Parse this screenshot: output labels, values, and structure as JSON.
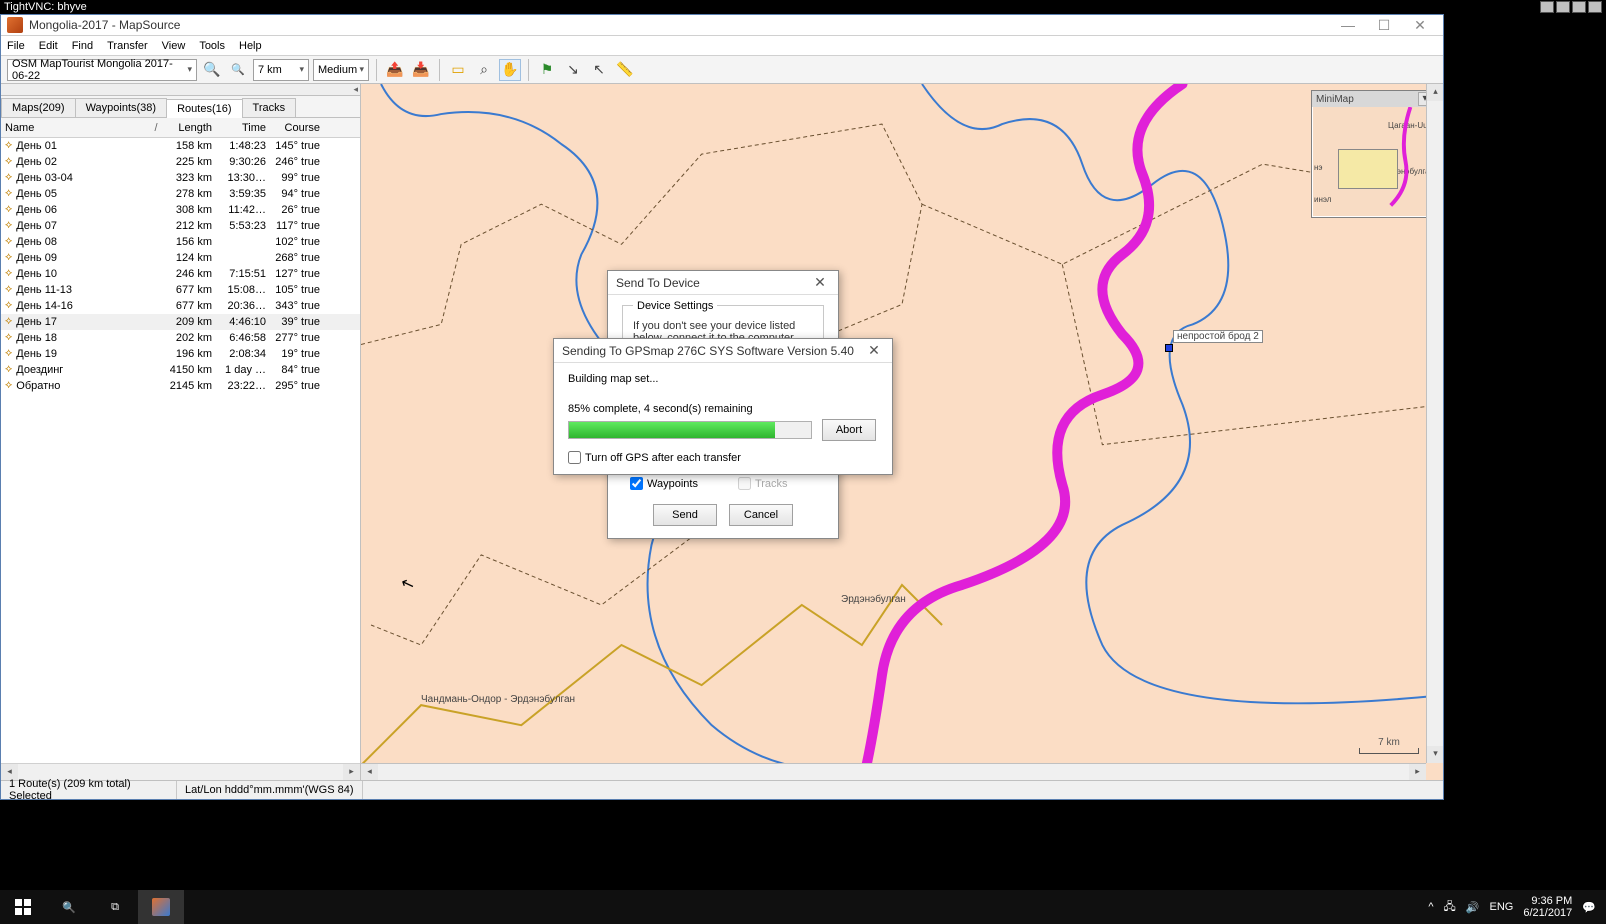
{
  "vnc": {
    "title": "TightVNC: bhyve"
  },
  "app": {
    "title": "Mongolia-2017 - MapSource",
    "menu": [
      "File",
      "Edit",
      "Find",
      "Transfer",
      "View",
      "Tools",
      "Help"
    ],
    "map_product": "OSM MapTourist Mongolia 2017-06-22",
    "zoom_scale": "7 km",
    "detail": "Medium"
  },
  "tabs": {
    "maps": "Maps(209)",
    "waypoints": "Waypoints(38)",
    "routes": "Routes(16)",
    "tracks": "Tracks"
  },
  "grid": {
    "cols": {
      "name": "Name",
      "sort": "/",
      "length": "Length",
      "time": "Time",
      "course": "Course"
    },
    "rows": [
      {
        "name": "День 01",
        "len": "158 km",
        "time": "1:48:23",
        "course": "145° true"
      },
      {
        "name": "День 02",
        "len": "225 km",
        "time": "9:30:26",
        "course": "246° true"
      },
      {
        "name": "День 03-04",
        "len": "323 km",
        "time": "13:30…",
        "course": "99° true"
      },
      {
        "name": "День 05",
        "len": "278 km",
        "time": "3:59:35",
        "course": "94° true"
      },
      {
        "name": "День 06",
        "len": "308 km",
        "time": "11:42…",
        "course": "26° true"
      },
      {
        "name": "День 07",
        "len": "212 km",
        "time": "5:53:23",
        "course": "117° true"
      },
      {
        "name": "День 08",
        "len": "156 km",
        "time": "",
        "course": "102° true"
      },
      {
        "name": "День 09",
        "len": "124 km",
        "time": "",
        "course": "268° true"
      },
      {
        "name": "День 10",
        "len": "246 km",
        "time": "7:15:51",
        "course": "127° true"
      },
      {
        "name": "День 11-13",
        "len": "677 km",
        "time": "15:08…",
        "course": "105° true"
      },
      {
        "name": "День 14-16",
        "len": "677 km",
        "time": "20:36…",
        "course": "343° true"
      },
      {
        "name": "День 17",
        "len": "209 km",
        "time": "4:46:10",
        "course": "39° true",
        "sel": true
      },
      {
        "name": "День 18",
        "len": "202 km",
        "time": "6:46:58",
        "course": "277° true"
      },
      {
        "name": "День 19",
        "len": "196 km",
        "time": "2:08:34",
        "course": "19° true"
      },
      {
        "name": "Доездинг",
        "len": "4150 km",
        "time": "1 day …",
        "course": "84° true"
      },
      {
        "name": "Обратно",
        "len": "2145 km",
        "time": "23:22…",
        "course": "295° true"
      }
    ]
  },
  "dlg_device": {
    "title": "Send To Device",
    "group": "Device Settings",
    "hint": "If you don't see your device listed below, connect it to the computer and turn it on.",
    "chk_waypoints": "Waypoints",
    "chk_tracks": "Tracks",
    "btn_send": "Send",
    "btn_cancel": "Cancel"
  },
  "dlg_progress": {
    "title": "Sending To GPSmap 276C SYS Software Version 5.40",
    "task": "Building map set...",
    "status": "85% complete, 4 second(s) remaining",
    "percent": 85,
    "chk_off": "Turn off GPS after each transfer",
    "btn_abort": "Abort"
  },
  "status": {
    "sel": "1 Route(s) (209 km total) Selected",
    "coord": "Lat/Lon hddd°mm.mmm'(WGS 84)"
  },
  "minimap": {
    "title": "MiniMap",
    "l1": "Цагаан-Uup",
    "l2": "Эрдэнэбулган",
    "l3": "нэ",
    "l4": "инэл"
  },
  "map_labels": {
    "wp": "непростой брод 2",
    "town": "Эрдэнэбулган",
    "road": "Чандмань-Ондор - Эрдэнэбулган",
    "scale": "7 km"
  },
  "tray": {
    "lang": "ENG",
    "time": "9:36 PM",
    "date": "6/21/2017"
  }
}
